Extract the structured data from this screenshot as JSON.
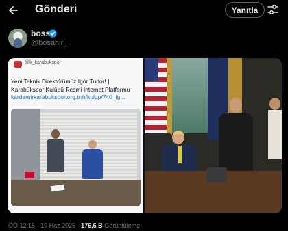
{
  "header": {
    "title": "Gönderi",
    "reply_label": "Yanıtla"
  },
  "post": {
    "author_name": "boss",
    "author_handle": "@bosahin_"
  },
  "embedded_post": {
    "handle": "@k_karabukspor",
    "line1": "Yeni Teknik Direktörümüz Igor Tudor! |",
    "line2": "Karabükspor Kulübü Resmi İnternet Platformu",
    "link": "kardemirkarabukspor.org.tr/h/kulup/740_ig..."
  },
  "meta": {
    "time": "ÖÖ 12:15",
    "separator": "·",
    "date": "19 Haz 2025",
    "views_count": "176,6 B",
    "views_label": "Görüntüleme"
  },
  "colors": {
    "link_blue": "#1d6fbf",
    "verified_blue": "#1d9bf0",
    "muted_text": "#71767b"
  },
  "icons": [
    "back-arrow-icon",
    "settings-sliders-icon",
    "verified-badge-icon"
  ]
}
